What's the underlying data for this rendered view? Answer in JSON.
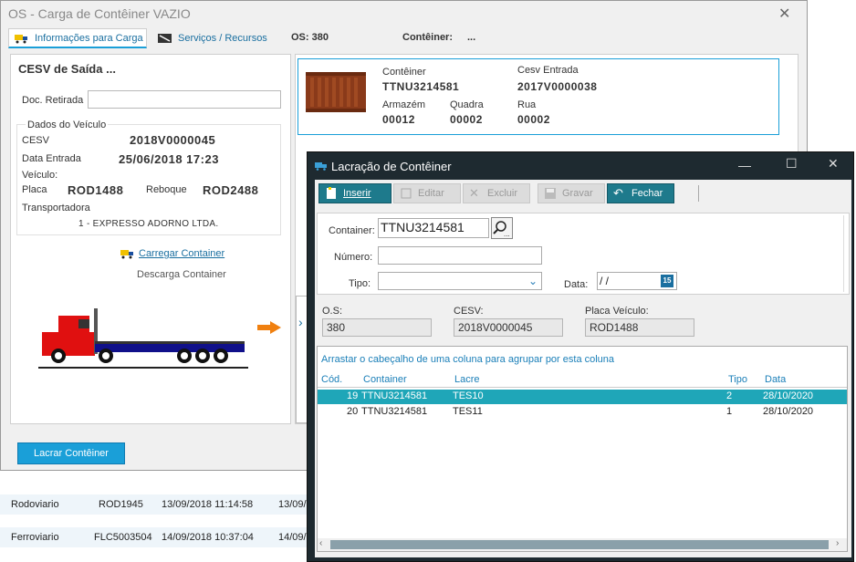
{
  "main_window": {
    "title": "OS - Carga de Contêiner VAZIO",
    "close_glyph": "✕",
    "tabs": [
      {
        "label": "Informações para Carga"
      },
      {
        "label": "Serviços / Recursos"
      }
    ],
    "os_label": "OS: 380",
    "container_label": "Contêiner:",
    "container_value": "..."
  },
  "left_panel": {
    "title": "CESV de Saída ...",
    "doc_retirada_label": "Doc. Retirada",
    "vehicle_group_label": "Dados do Veículo",
    "cesv_label": "CESV",
    "cesv_value": "2018V0000045",
    "data_entrada_label": "Data Entrada",
    "data_entrada_value": "25/06/2018 17:23",
    "veiculo_label": "Veículo:",
    "placa_label": "Placa",
    "placa_value": "ROD1488",
    "reboque_label": "Reboque",
    "reboque_value": "ROD2488",
    "transportadora_label": "Transportadora",
    "transportadora_value": "1 - EXPRESSO ADORNO LTDA.",
    "carregar_link": "Carregar Container",
    "descarga_link": "Descarga Container"
  },
  "container_info": {
    "conteiner_label": "Contêiner",
    "conteiner_value": "TTNU3214581",
    "cesv_entrada_label": "Cesv Entrada",
    "cesv_entrada_value": "2017V0000038",
    "armazem_label": "Armazém",
    "armazem_value": "00012",
    "quadra_label": "Quadra",
    "quadra_value": "00002",
    "rua_label": "Rua",
    "rua_value": "00002"
  },
  "lacrar_button": "Lacrar Contêiner",
  "background_rows": [
    {
      "col1": "Rodoviario",
      "col2": "ROD1945",
      "col3": "13/09/2018 11:14:58",
      "col4": "13/09/"
    },
    {
      "col1": "Ferroviario",
      "col2": "FLC5003504",
      "col3": "14/09/2018 10:37:04",
      "col4": "14/09/"
    }
  ],
  "dialog": {
    "title": "Lacração de Contêiner",
    "toolbar": {
      "inserir": "Inserir",
      "editar": "Editar",
      "excluir": "Excluir",
      "gravar": "Gravar",
      "fechar": "Fechar"
    },
    "form": {
      "container_label": "Container:",
      "container_value": "TTNU3214581",
      "numero_label": "Número:",
      "numero_value": "",
      "tipo_label": "Tipo:",
      "tipo_value": "",
      "data_label": "Data:",
      "data_value": " / /",
      "calendar_day": "15"
    },
    "info": {
      "os_label": "O.S:",
      "os_value": "380",
      "cesv_label": "CESV:",
      "cesv_value": "2018V0000045",
      "placa_label": "Placa Veículo:",
      "placa_value": "ROD1488"
    },
    "grid": {
      "group_hint": "Arrastar o cabeçalho de uma coluna para agrupar por esta coluna",
      "headers": [
        "Cód.",
        "Container",
        "Lacre",
        "Tipo",
        "Data"
      ],
      "rows": [
        {
          "cod": "19",
          "container": "TTNU3214581",
          "lacre": "TES10",
          "tipo": "2",
          "data": "28/10/2020",
          "selected": true
        },
        {
          "cod": "20",
          "container": "TTNU3214581",
          "lacre": "TES11",
          "tipo": "1",
          "data": "28/10/2020",
          "selected": false
        }
      ]
    }
  },
  "colors": {
    "accent": "#1a9fd8",
    "dialog_titlebar": "#1e2a30",
    "toolbar_button": "#1e7a8c",
    "selected_row": "#1fa6b8",
    "truck_red": "#e01010",
    "trailer_blue": "#10108a",
    "container_brown": "#8a3a1a"
  }
}
